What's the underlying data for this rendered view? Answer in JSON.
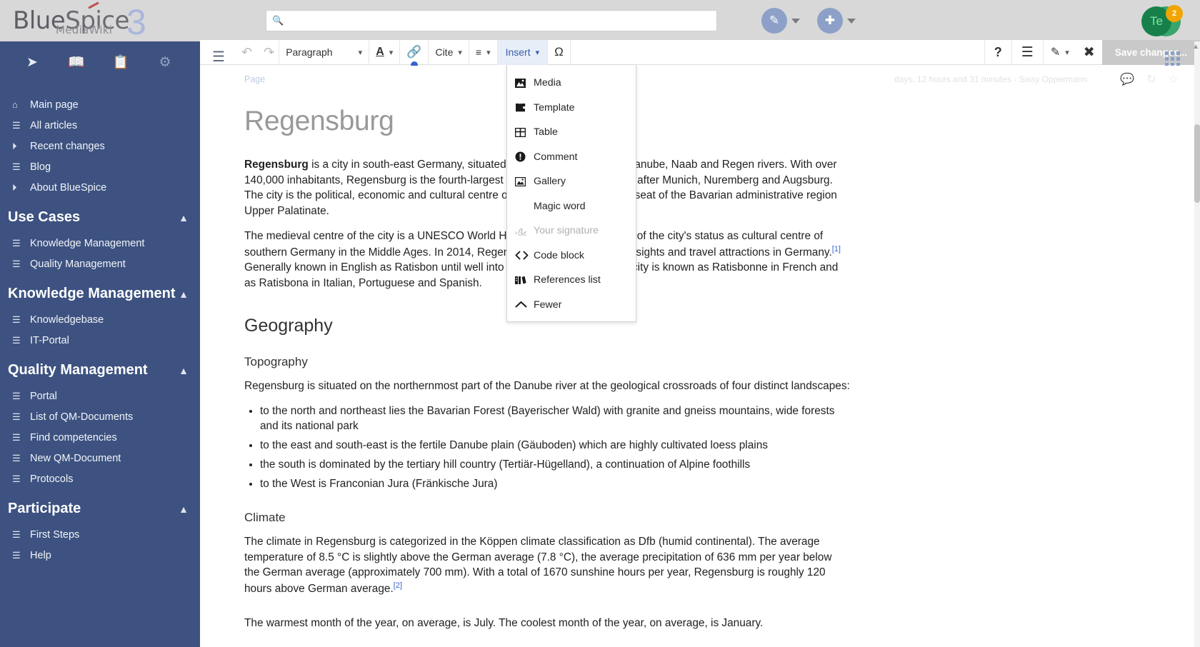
{
  "brand": {
    "name_part1": "Blue",
    "name_part2": "Spice",
    "version": "3",
    "subtitle": "MediaWiki"
  },
  "topbar": {
    "search_placeholder": "",
    "search_value": "",
    "search_icon": "search-icon",
    "edit_button_icon": "pencil-icon",
    "add_button_icon": "plus-icon",
    "avatar_initials": "Te",
    "avatar_badge": "2",
    "colors": {
      "bar_bg": "#d8d8d8",
      "avatar_bg": "#17804a",
      "badge_bg": "#f0a500"
    }
  },
  "sidebar": {
    "color": "#3d5280",
    "top_icons": [
      {
        "name": "navigation-icon",
        "glyph": "➤"
      },
      {
        "name": "book-icon",
        "glyph": "📖"
      },
      {
        "name": "clipboard-icon",
        "glyph": "📋"
      },
      {
        "name": "gear-icon",
        "glyph": "⚙"
      }
    ],
    "main_links": [
      {
        "label": "Main page",
        "icon": "home-icon",
        "glyph": "⌂"
      },
      {
        "label": "All articles",
        "icon": "document-icon",
        "glyph": "☰"
      },
      {
        "label": "Recent changes",
        "icon": "clock-icon",
        "glyph": "◴"
      },
      {
        "label": "Blog",
        "icon": "document-icon",
        "glyph": "☰"
      },
      {
        "label": "About BlueSpice",
        "icon": "clock-icon",
        "glyph": "◴"
      }
    ],
    "sections": [
      {
        "title": "Use Cases",
        "chevron": "chevron-up-icon",
        "items": [
          {
            "label": "Knowledge Management",
            "icon": "document-icon"
          },
          {
            "label": "Quality Management",
            "icon": "document-icon"
          }
        ]
      },
      {
        "title": "Knowledge Management",
        "chevron": "chevron-up-icon",
        "items": [
          {
            "label": "Knowledgebase",
            "icon": "document-icon"
          },
          {
            "label": "IT-Portal",
            "icon": "document-icon"
          }
        ]
      },
      {
        "title": "Quality Management",
        "chevron": "chevron-up-icon",
        "items": [
          {
            "label": "Portal",
            "icon": "document-icon"
          },
          {
            "label": "List of QM-Documents",
            "icon": "document-icon"
          },
          {
            "label": "Find competencies",
            "icon": "document-icon"
          },
          {
            "label": "New QM-Document",
            "icon": "document-icon"
          },
          {
            "label": "Protocols",
            "icon": "document-icon"
          }
        ]
      },
      {
        "title": "Participate",
        "chevron": "chevron-up-icon",
        "items": [
          {
            "label": "First Steps",
            "icon": "document-icon"
          },
          {
            "label": "Help",
            "icon": "document-icon"
          }
        ]
      }
    ]
  },
  "toolbar": {
    "hamburger_icon": "hamburger-icon",
    "undo_label": "↶",
    "redo_label": "↷",
    "paragraph_style": "Paragraph",
    "text_style_label": "A",
    "link_icon": "link-icon",
    "cite_label": "Cite",
    "list_icon": "list-icon",
    "insert_label": "Insert",
    "special_char_label": "Ω",
    "help_label": "?",
    "page_options_icon": "hamburger-icon",
    "edit_mode_icon": "pencil-icon",
    "cancel_icon": "close-circle-icon",
    "save_label": "Save changes...",
    "grid_icon": "grid-icon"
  },
  "insert_menu": {
    "items": [
      {
        "label": "Media",
        "icon": "image-icon",
        "disabled": false
      },
      {
        "label": "Template",
        "icon": "puzzle-icon",
        "disabled": false
      },
      {
        "label": "Table",
        "icon": "table-icon",
        "disabled": false
      },
      {
        "label": "Comment",
        "icon": "exclamation-circle-icon",
        "disabled": false
      },
      {
        "label": "Gallery",
        "icon": "gallery-icon",
        "disabled": false
      },
      {
        "label": "Magic word",
        "icon": "",
        "disabled": false
      },
      {
        "label": "Your signature",
        "icon": "signature-icon",
        "disabled": true
      },
      {
        "label": "Code block",
        "icon": "code-icon",
        "disabled": false
      },
      {
        "label": "References list",
        "icon": "references-icon",
        "disabled": false
      },
      {
        "label": "Fewer",
        "icon": "chevron-up-icon",
        "disabled": false
      }
    ]
  },
  "page": {
    "breadcrumb": "Page",
    "last_edit": "days, 12 hours and 31 minutes - Sissy Oppermann",
    "meta_icons": [
      {
        "name": "discussion-icon",
        "glyph": "💬"
      },
      {
        "name": "history-icon",
        "glyph": "↺"
      },
      {
        "name": "watch-star-icon",
        "glyph": "☆"
      }
    ],
    "title": "Regensburg",
    "intro_bold": "Regensburg",
    "intro_rest": " is a city in south-east Germany, situated at the confluence of the Danube, Naab and Regen rivers. With over 140,000 inhabitants, Regensburg is the fourth-largest city in the State of Bavaria after Munich, Nuremberg and Augsburg. The city is the political, economic and cultural centre of Eastern Bavaria and the seat of the Bavarian administrative region Upper Palatinate.",
    "para2_a": "The medieval centre of the city is a UNESCO World Heritage Site, in recognition of the city's status as cultural centre of southern Germany in the Middle Ages. In 2014, Regensburg was among the top sights and travel attractions in Germany.",
    "ref1": "[1]",
    "para2_b": " Generally known in English as Ratisbon until well into the twentieth century, the city is known as Ratisbonne in French and as Ratisbona in Italian, Portuguese and Spanish.",
    "h_geography": "Geography",
    "h_topography": "Topography",
    "topo_intro": "Regensburg is situated on the northernmost part of the Danube river at the geological crossroads of four distinct landscapes:",
    "topo_items": [
      "to the north and northeast lies the Bavarian Forest (Bayerischer Wald) with granite and gneiss mountains, wide forests and its national park",
      "to the east and south-east is the fertile Danube plain (Gäuboden) which are highly cultivated loess plains",
      "the south is dominated by the tertiary hill country (Tertiär-Hügelland), a continuation of Alpine foothills",
      "to the West is Franconian Jura (Fränkische Jura)"
    ],
    "h_climate": "Climate",
    "climate_a": "The climate in Regensburg is categorized in the Köppen climate classification as Dfb (humid continental). The average temperature of 8.5 °C is slightly above the German average (7.8 °C), the average precipitation of 636 mm per year below the German average (approximately 700 mm). With a total of 1670 sunshine hours per year, Regensburg is roughly 120 hours above German average.",
    "ref2": "[2]",
    "climate_b": "The warmest month of the year, on average, is July. The coolest month of the year, on average, is January."
  }
}
